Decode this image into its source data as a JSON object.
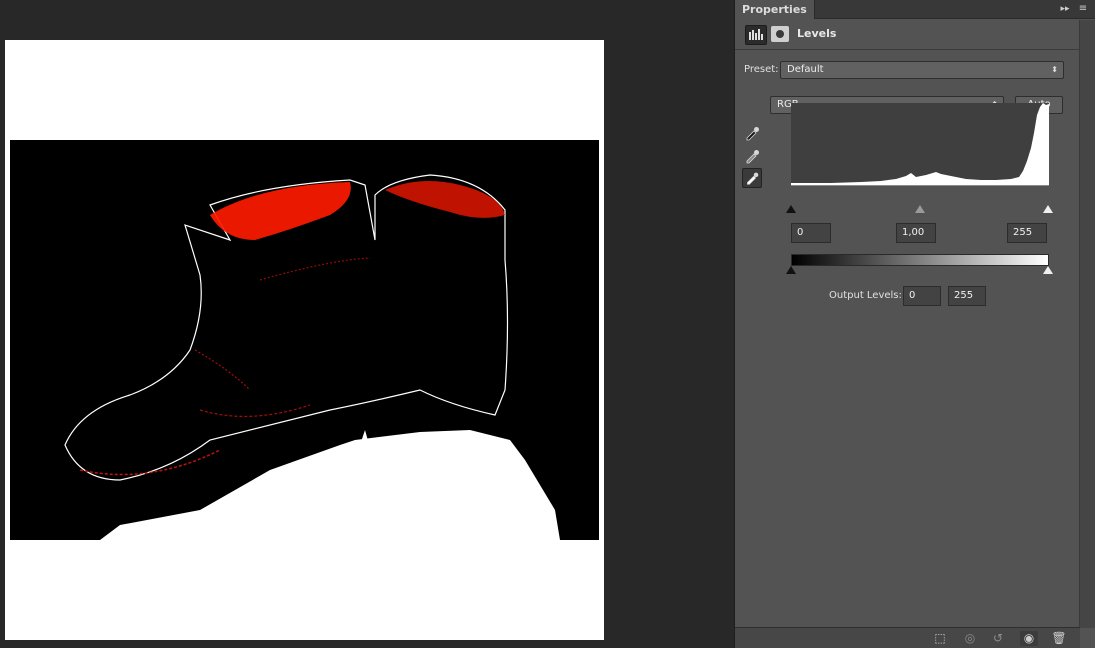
{
  "panel": {
    "tab_label": "Properties",
    "collapse_glyph": "▸▸",
    "menu_glyph": "≡",
    "title": "Levels"
  },
  "preset": {
    "label": "Preset:",
    "value": "Default"
  },
  "channel": {
    "value": "RGB",
    "auto_label": "Auto"
  },
  "input_levels": {
    "black": "0",
    "gamma": "1,00",
    "white": "255"
  },
  "output_levels": {
    "label": "Output Levels:",
    "black": "0",
    "white": "255"
  },
  "icons": {
    "adjustment": "levels-adjustment-icon",
    "mask": "layer-mask-icon",
    "eyedroppers": [
      "black-point-eyedropper-icon",
      "gray-point-eyedropper-icon",
      "white-point-eyedropper-icon"
    ],
    "footer": [
      "clip-to-layer-icon",
      "view-previous-state-icon",
      "reset-icon",
      "visibility-eye-icon",
      "trash-icon"
    ]
  },
  "colors": {
    "panel_bg": "#535353",
    "canvas_bg": "#282828",
    "document_bg": "#ffffff"
  }
}
